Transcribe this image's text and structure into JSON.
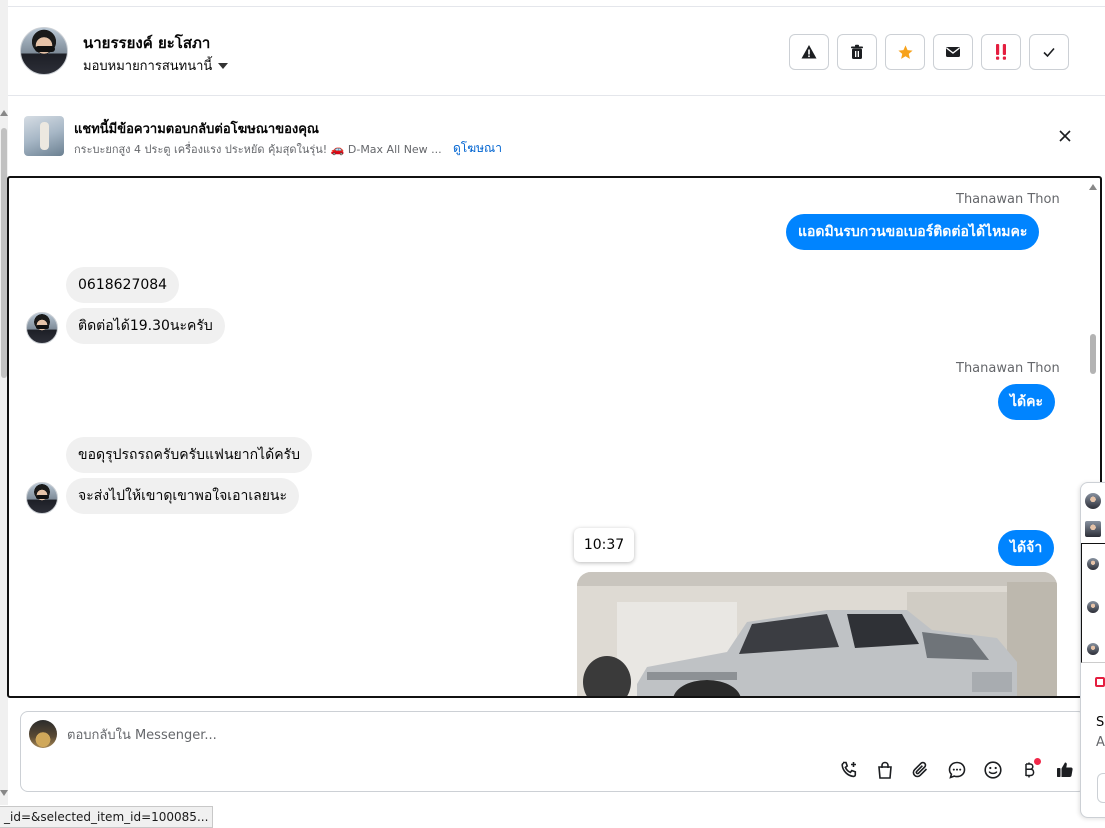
{
  "header": {
    "contact_name": "นายรรยงค์ ยะโสภา",
    "assign_label": "มอบหมายการสนทนานี้",
    "actions": [
      "spam-warning",
      "delete",
      "star",
      "mark-unread",
      "follow-up",
      "done"
    ]
  },
  "ad_reply": {
    "title": "แชทนี้มีข้อความตอบกลับต่อโฆษณาของคุณ",
    "subtitle": "กระบะยกสูง 4 ประตู เครื่องแรง ประหยัด คุ้มสุดในรุ่น! 🚗 D-Max All New ...",
    "link": "ดูโฆษณา"
  },
  "messages": [
    {
      "sender": "Thanawan Thon",
      "text": "แอดมินรบกวนขอเบอร์ติดต่อได้ไหมคะ",
      "dir": "out"
    },
    {
      "text": "0618627084",
      "dir": "in"
    },
    {
      "text": "ติดต่อได้19.30นะครับ",
      "dir": "in"
    },
    {
      "sender": "Thanawan Thon",
      "text": "ได้คะ",
      "dir": "out"
    },
    {
      "text": "ขอดุรุปรถรถครับครับแฟนยากได้ครับ",
      "dir": "in"
    },
    {
      "text": "จะส่งไปให้เขาดุเขาพอใจเอาเลยนะ",
      "dir": "in"
    },
    {
      "text": "ได้จ้า",
      "dir": "out"
    }
  ],
  "tooltip_time": "10:37",
  "composer": {
    "placeholder": "ตอบกลับใน Messenger..."
  },
  "right_panel": {
    "text_1": "S",
    "text_2": "A"
  },
  "status_bar": "_id=&selected_item_id=100085...",
  "colors": {
    "outgoing_bubble": "#0084ff",
    "incoming_bubble": "#f0f0f0",
    "link": "#0064d1",
    "star": "#f7a21b",
    "follow_up": "#e41e3f"
  }
}
